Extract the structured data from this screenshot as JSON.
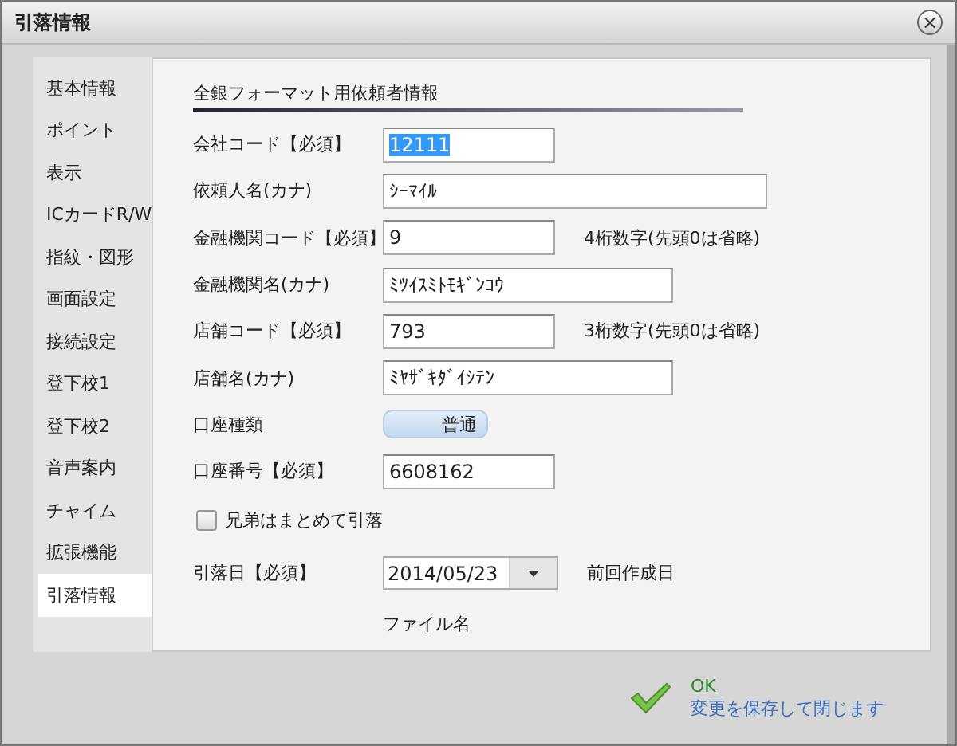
{
  "window": {
    "title": "引落情報",
    "close": "×"
  },
  "sidebar": {
    "items": [
      {
        "label": "基本情報",
        "selected": false
      },
      {
        "label": "ポイント",
        "selected": false
      },
      {
        "label": "表示",
        "selected": false
      },
      {
        "label": "ICカードR/W",
        "selected": false
      },
      {
        "label": "指紋・図形",
        "selected": false
      },
      {
        "label": "画面設定",
        "selected": false
      },
      {
        "label": "接続設定",
        "selected": false
      },
      {
        "label": "登下校1",
        "selected": false
      },
      {
        "label": "登下校2",
        "selected": false
      },
      {
        "label": "音声案内",
        "selected": false
      },
      {
        "label": "チャイム",
        "selected": false
      },
      {
        "label": "拡張機能",
        "selected": false
      },
      {
        "label": "引落情報",
        "selected": true
      }
    ]
  },
  "section_title": "全銀フォーマット用依頼者情報",
  "fields": [
    {
      "kind": "input",
      "label": "会社コード【必須】",
      "value": "12111",
      "highlighted": true
    },
    {
      "kind": "input",
      "label": "依頼人名(カナ)",
      "value": "ｼｰﾏｲﾙ",
      "highlighted": false
    },
    {
      "kind": "input",
      "label": "金融機関コード【必須】",
      "value": "9",
      "highlighted": false,
      "note": "4桁数字(先頭0は省略)"
    },
    {
      "kind": "input",
      "label": "金融機関名(カナ)",
      "value": "ﾐﾂｲｽﾐﾄﾓｷﾞﾝｺｳ",
      "highlighted": false
    },
    {
      "kind": "input",
      "label": "店舗コード【必須】",
      "value": "793",
      "highlighted": false,
      "note": "3桁数字(先頭0は省略)"
    },
    {
      "kind": "input",
      "label": "店舗名(カナ)",
      "value": "ﾐﾔｻﾞｷﾀﾞｲｼﾃﾝ",
      "highlighted": false
    },
    {
      "kind": "toggle",
      "label": "口座種類",
      "value": "普通"
    },
    {
      "kind": "input",
      "label": "口座番号【必須】",
      "value": "6608162",
      "highlighted": false
    },
    {
      "kind": "checkbox",
      "label": "兄弟はまとめて引落",
      "checked": false
    },
    {
      "kind": "date",
      "label": "引落日【必須】",
      "value": "2014/05/23",
      "note": "前回作成日"
    },
    {
      "kind": "text",
      "value": "ファイル名"
    }
  ],
  "ok_button": {
    "label": "OK",
    "description": "変更を保存して閉じます"
  }
}
